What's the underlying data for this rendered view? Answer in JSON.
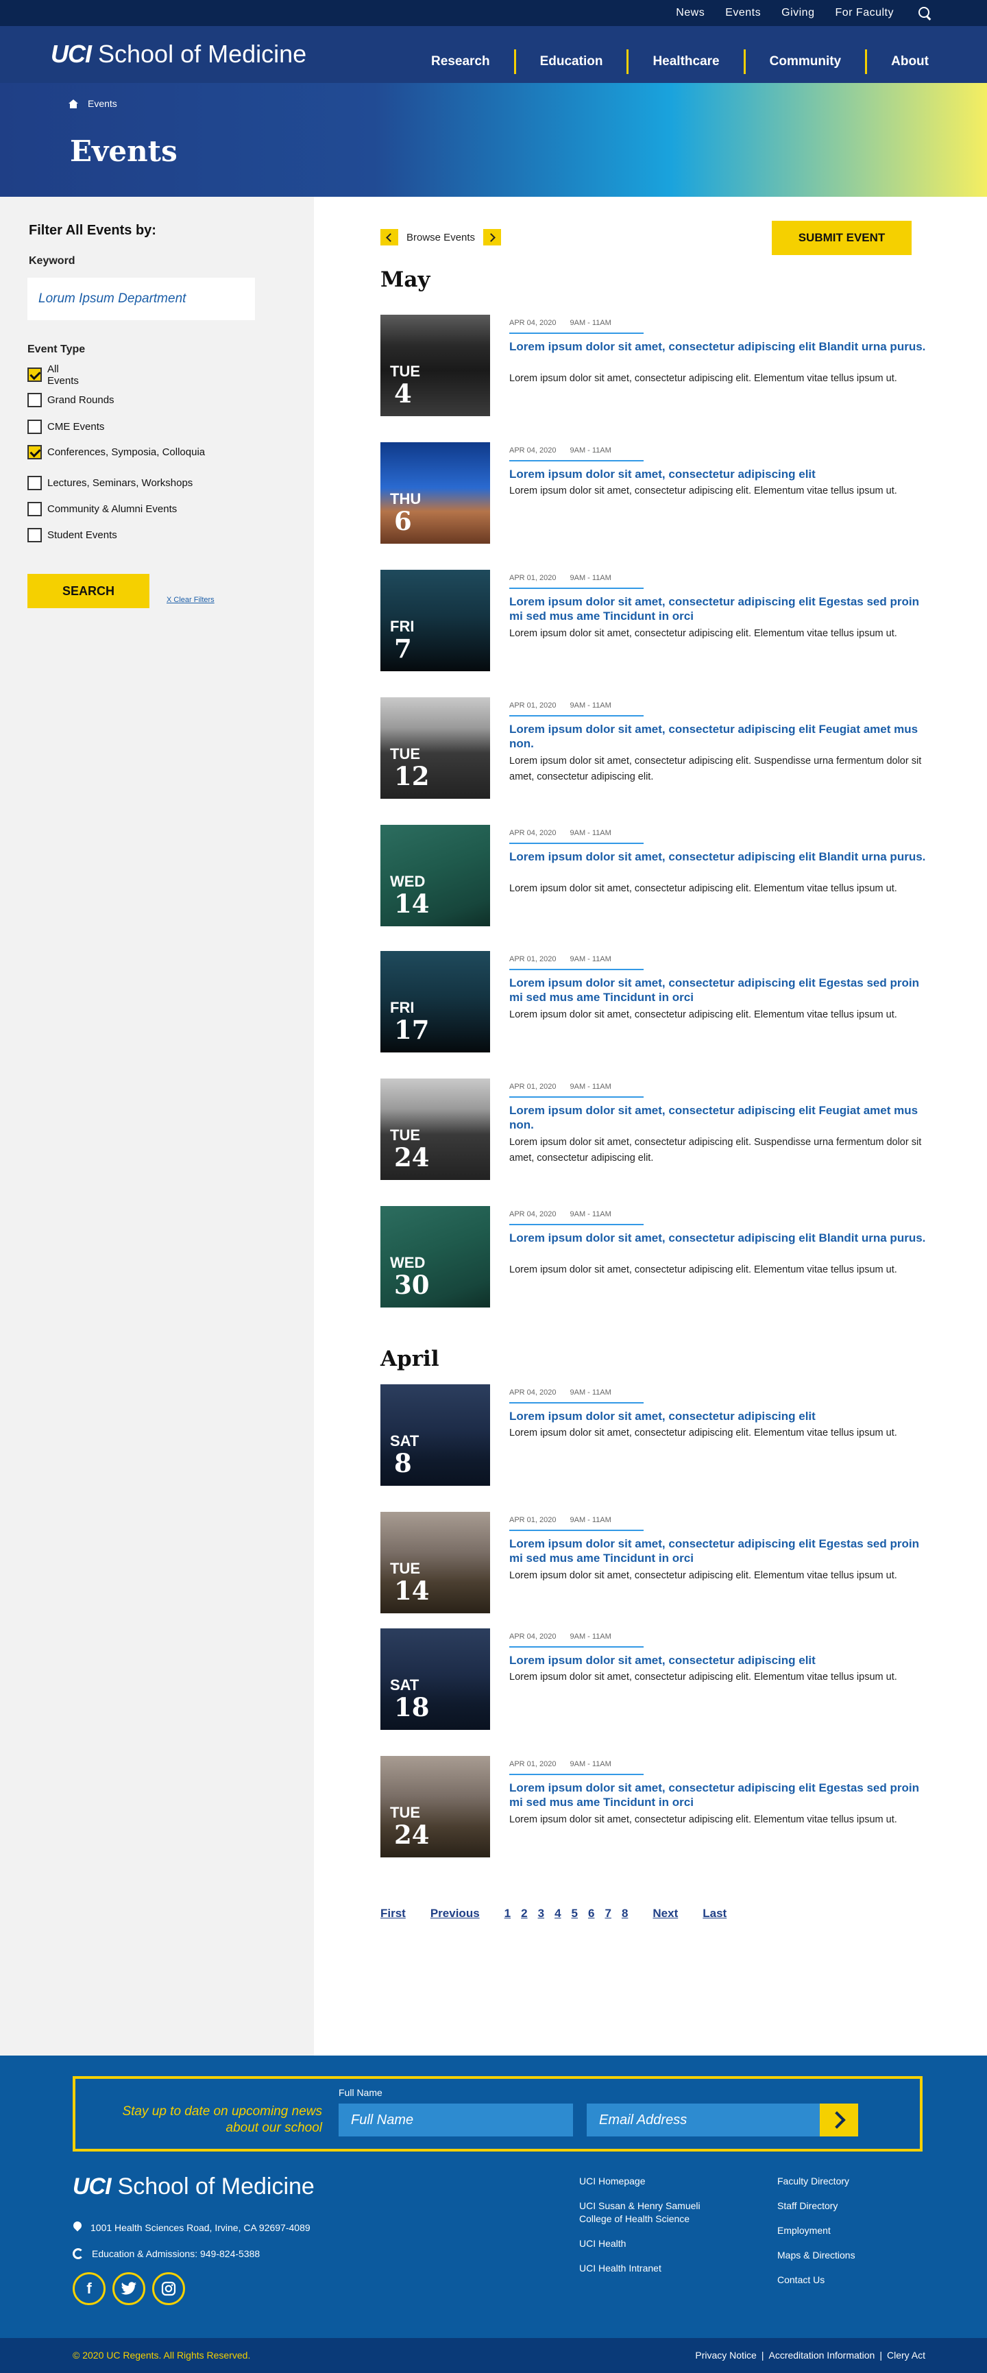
{
  "topnav": {
    "links": [
      "News",
      "Events",
      "Giving",
      "For Faculty"
    ]
  },
  "brand": {
    "bold": "UCI",
    "name": "School of Medicine"
  },
  "mainnav": [
    "Research",
    "Education",
    "Healthcare",
    "Community",
    "About"
  ],
  "hero": {
    "breadcrumb": "Events",
    "title": "Events"
  },
  "filters": {
    "title": "Filter All Events by:",
    "keyword_label": "Keyword",
    "keyword_placeholder": "Lorum Ipsum Department",
    "event_type_label": "Event Type",
    "options": [
      {
        "label": "All Events",
        "checked": true
      },
      {
        "label": "Grand Rounds",
        "checked": false
      },
      {
        "label": "CME Events",
        "checked": false
      },
      {
        "label": "Conferences, Symposia, Colloquia",
        "checked": true
      },
      {
        "label": "Lectures, Seminars, Workshops",
        "checked": false
      },
      {
        "label": "Community & Alumni Events",
        "checked": false
      },
      {
        "label": "Student Events",
        "checked": false
      }
    ],
    "search_button": "SEARCH",
    "clear": "X Clear Filters"
  },
  "browse": {
    "label": "Browse Events",
    "submit": "SUBMIT EVENT"
  },
  "months": [
    "May",
    "April"
  ],
  "events": [
    {
      "day": "TUE",
      "num": "4",
      "date": "APR 04, 2020",
      "time": "9AM - 11AM",
      "title": "Lorem ipsum dolor sit amet, consectetur adipiscing elit Blandit urna purus.",
      "desc": "Lorem ipsum dolor sit amet, consectetur adipiscing elit. Elementum vitae tellus ipsum ut."
    },
    {
      "day": "THU",
      "num": "6",
      "date": "APR 04, 2020",
      "time": "9AM - 11AM",
      "title": "Lorem ipsum dolor sit amet, consectetur adipiscing elit",
      "desc": "Lorem ipsum dolor sit amet, consectetur adipiscing elit. Elementum vitae tellus ipsum ut."
    },
    {
      "day": "FRI",
      "num": "7",
      "date": "APR 01, 2020",
      "time": "9AM - 11AM",
      "title": "Lorem ipsum dolor sit amet, consectetur adipiscing elit Egestas sed proin mi sed mus ame Tincidunt in orci",
      "desc": "Lorem ipsum dolor sit amet, consectetur adipiscing elit. Elementum vitae tellus ipsum ut."
    },
    {
      "day": "TUE",
      "num": "12",
      "date": "APR 01, 2020",
      "time": "9AM - 11AM",
      "title": "Lorem ipsum dolor sit amet, consectetur adipiscing elit Feugiat amet mus non.",
      "desc": "Lorem ipsum dolor sit amet, consectetur adipiscing elit. Suspendisse urna fermentum dolor sit amet, consectetur adipiscing elit."
    },
    {
      "day": "WED",
      "num": "14",
      "date": "APR 04, 2020",
      "time": "9AM - 11AM",
      "title": "Lorem ipsum dolor sit amet, consectetur adipiscing elit Blandit urna purus.",
      "desc": "Lorem ipsum dolor sit amet, consectetur adipiscing elit. Elementum vitae tellus ipsum ut."
    },
    {
      "day": "FRI",
      "num": "17",
      "date": "APR 01, 2020",
      "time": "9AM - 11AM",
      "title": "Lorem ipsum dolor sit amet, consectetur adipiscing elit Egestas sed proin mi sed mus ame Tincidunt in orci",
      "desc": "Lorem ipsum dolor sit amet, consectetur adipiscing elit. Elementum vitae tellus ipsum ut."
    },
    {
      "day": "TUE",
      "num": "24",
      "date": "APR 01, 2020",
      "time": "9AM - 11AM",
      "title": "Lorem ipsum dolor sit amet, consectetur adipiscing elit Feugiat amet mus non.",
      "desc": "Lorem ipsum dolor sit amet, consectetur adipiscing elit. Suspendisse urna fermentum dolor sit amet, consectetur adipiscing elit."
    },
    {
      "day": "WED",
      "num": "30",
      "date": "APR 04, 2020",
      "time": "9AM - 11AM",
      "title": "Lorem ipsum dolor sit amet, consectetur adipiscing elit Blandit urna purus.",
      "desc": "Lorem ipsum dolor sit amet, consectetur adipiscing elit. Elementum vitae tellus ipsum ut."
    },
    {
      "day": "SAT",
      "num": "8",
      "date": "APR 04, 2020",
      "time": "9AM - 11AM",
      "title": "Lorem ipsum dolor sit amet, consectetur adipiscing elit",
      "desc": "Lorem ipsum dolor sit amet, consectetur adipiscing elit. Elementum vitae tellus ipsum ut."
    },
    {
      "day": "TUE",
      "num": "14",
      "date": "APR 01, 2020",
      "time": "9AM - 11AM",
      "title": "Lorem ipsum dolor sit amet, consectetur adipiscing elit Egestas sed proin mi sed mus ame Tincidunt in orci",
      "desc": "Lorem ipsum dolor sit amet, consectetur adipiscing elit. Elementum vitae tellus ipsum ut."
    },
    {
      "day": "SAT",
      "num": "18",
      "date": "APR 04, 2020",
      "time": "9AM - 11AM",
      "title": "Lorem ipsum dolor sit amet, consectetur adipiscing elit",
      "desc": "Lorem ipsum dolor sit amet, consectetur adipiscing elit. Elementum vitae tellus ipsum ut."
    },
    {
      "day": "TUE",
      "num": "24",
      "date": "APR 01, 2020",
      "time": "9AM - 11AM",
      "title": "Lorem ipsum dolor sit amet, consectetur adipiscing elit Egestas sed proin mi sed mus ame Tincidunt in orci",
      "desc": "Lorem ipsum dolor sit amet, consectetur adipiscing elit. Elementum vitae tellus ipsum ut."
    }
  ],
  "pagination": {
    "first": "First",
    "previous": "Previous",
    "pages": [
      "1",
      "2",
      "3",
      "4",
      "5",
      "6",
      "7",
      "8"
    ],
    "next": "Next",
    "last": "Last"
  },
  "footer": {
    "newsletter_text": "Stay up to date on upcoming news about our school",
    "full_name_label": "Full Name",
    "full_name_placeholder": "Full Name",
    "email_placeholder": "Email Address",
    "address": "1001 Health Sciences Road, Irvine, CA 92697-4089",
    "admissions": "Education & Admissions: 949-824-5388",
    "col1": [
      "UCI Homepage",
      "UCI Susan & Henry Samueli College of Health Science",
      "UCI Health",
      "UCI Health Intranet"
    ],
    "col2": [
      "Faculty Directory",
      "Staff Directory",
      "Employment",
      "Maps & Directions",
      "Contact Us"
    ],
    "copyright": "© 2020 UC Regents. All Rights Reserved.",
    "legal": [
      "Privacy Notice",
      "Accreditation Information",
      "Clery Act"
    ]
  }
}
